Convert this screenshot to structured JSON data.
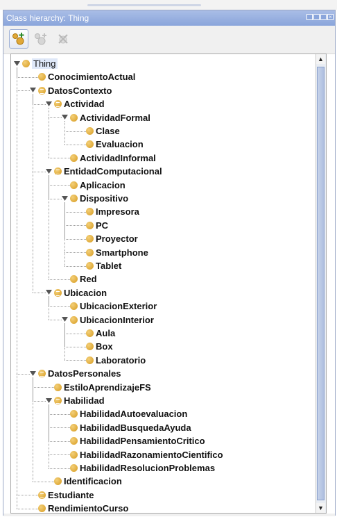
{
  "panel": {
    "title": "Class hierarchy: Thing"
  },
  "toolbar": {
    "buttons": [
      {
        "name": "add-subclass",
        "icon": "add-subclass-icon",
        "enabled": true
      },
      {
        "name": "add-sibling",
        "icon": "add-sibling-icon",
        "enabled": false
      },
      {
        "name": "delete-class",
        "icon": "delete-class-icon",
        "enabled": false
      }
    ]
  },
  "tree": {
    "nodes": [
      {
        "label": "Thing",
        "depth": 0,
        "expanded": true,
        "defined": false
      },
      {
        "label": "ConocimientoActual",
        "depth": 1,
        "defined": false
      },
      {
        "label": "DatosContexto",
        "depth": 1,
        "expanded": true,
        "defined": true
      },
      {
        "label": "Actividad",
        "depth": 2,
        "expanded": true,
        "defined": true
      },
      {
        "label": "ActividadFormal",
        "depth": 3,
        "expanded": true,
        "defined": false
      },
      {
        "label": "Clase",
        "depth": 4,
        "defined": false
      },
      {
        "label": "Evaluacion",
        "depth": 4,
        "defined": false
      },
      {
        "label": "ActividadInformal",
        "depth": 3,
        "defined": false
      },
      {
        "label": "EntidadComputacional",
        "depth": 2,
        "expanded": true,
        "defined": true
      },
      {
        "label": "Aplicacion",
        "depth": 3,
        "defined": false
      },
      {
        "label": "Dispositivo",
        "depth": 3,
        "expanded": true,
        "defined": false
      },
      {
        "label": "Impresora",
        "depth": 4,
        "defined": false
      },
      {
        "label": "PC",
        "depth": 4,
        "defined": false
      },
      {
        "label": "Proyector",
        "depth": 4,
        "defined": false
      },
      {
        "label": "Smartphone",
        "depth": 4,
        "defined": false
      },
      {
        "label": "Tablet",
        "depth": 4,
        "defined": false
      },
      {
        "label": "Red",
        "depth": 3,
        "defined": false
      },
      {
        "label": "Ubicacion",
        "depth": 2,
        "expanded": true,
        "defined": true
      },
      {
        "label": "UbicacionExterior",
        "depth": 3,
        "defined": false
      },
      {
        "label": "UbicacionInterior",
        "depth": 3,
        "expanded": true,
        "defined": false
      },
      {
        "label": "Aula",
        "depth": 4,
        "defined": false
      },
      {
        "label": "Box",
        "depth": 4,
        "defined": false
      },
      {
        "label": "Laboratorio",
        "depth": 4,
        "defined": false
      },
      {
        "label": "DatosPersonales",
        "depth": 1,
        "expanded": true,
        "defined": true
      },
      {
        "label": "EstiloAprendizajeFS",
        "depth": 2,
        "defined": false
      },
      {
        "label": "Habilidad",
        "depth": 2,
        "expanded": true,
        "defined": true
      },
      {
        "label": "HabilidadAutoevaluacion",
        "depth": 3,
        "defined": false
      },
      {
        "label": "HabilidadBusquedaAyuda",
        "depth": 3,
        "defined": false
      },
      {
        "label": "HabilidadPensamientoCritico",
        "depth": 3,
        "defined": false
      },
      {
        "label": "HabilidadRazonamientoCientifico",
        "depth": 3,
        "defined": false
      },
      {
        "label": "HabilidadResolucionProblemas",
        "depth": 3,
        "defined": false
      },
      {
        "label": "Identificacion",
        "depth": 2,
        "defined": false
      },
      {
        "label": "Estudiante",
        "depth": 1,
        "defined": true
      },
      {
        "label": "RendimientoCurso",
        "depth": 1,
        "defined": false
      }
    ]
  },
  "colors": {
    "title_bar": "#8aa5db",
    "class_icon": "#e0a838",
    "selection": "#dfe8f8"
  }
}
